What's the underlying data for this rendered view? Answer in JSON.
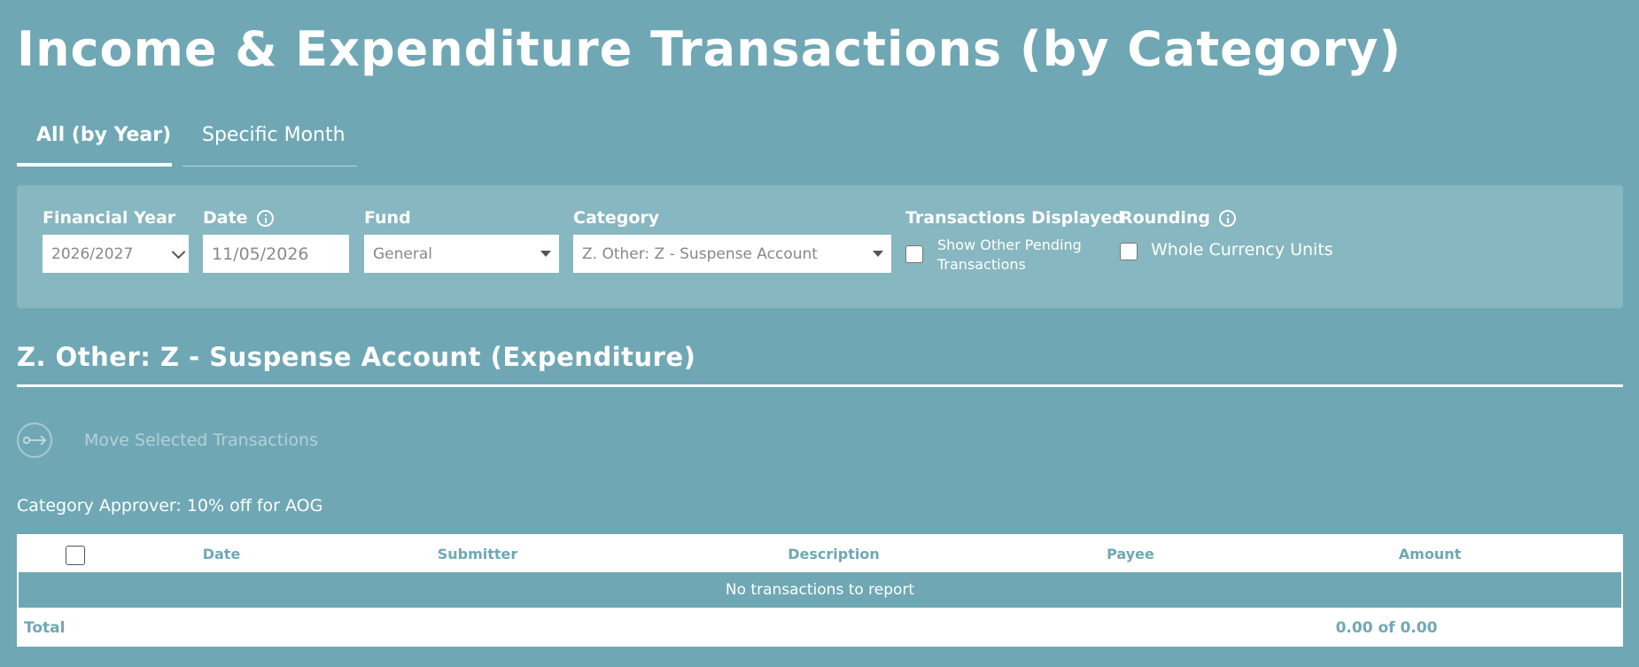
{
  "page": {
    "title": "Income & Expenditure Transactions (by Category)"
  },
  "tabs": [
    {
      "label": "All (by Year)",
      "active": true
    },
    {
      "label": "Specific Month",
      "active": false
    }
  ],
  "filters": {
    "financial_year": {
      "label": "Financial Year",
      "value": "2026/2027"
    },
    "date": {
      "label": "Date",
      "value": "11/05/2026"
    },
    "fund": {
      "label": "Fund",
      "value": "General"
    },
    "category": {
      "label": "Category",
      "value": "Z. Other: Z - Suspense Account"
    },
    "transactions_displayed": {
      "label": "Transactions Displayed",
      "option_line1": "Show Other Pending",
      "option_line2": "Transactions",
      "checked": false
    },
    "rounding": {
      "label": "Rounding",
      "option": "Whole Currency Units",
      "checked": false
    }
  },
  "section": {
    "heading": "Z. Other: Z - Suspense Account (Expenditure)"
  },
  "actions": {
    "move_label": "Move Selected Transactions"
  },
  "approver": {
    "text": "Category Approver: 10% off for AOG"
  },
  "table": {
    "columns": [
      "Date",
      "Submitter",
      "Description",
      "Payee",
      "Amount"
    ],
    "empty_message": "No transactions to report",
    "total_label": "Total",
    "total_amount": "0.00 of 0.00"
  },
  "colors": {
    "background": "#6fa8b4",
    "panel": "#87b7c0",
    "accent_text": "#6fa8b4"
  },
  "icons": [
    "info-icon",
    "chevron-down-icon",
    "caret-down-icon",
    "move-icon"
  ]
}
